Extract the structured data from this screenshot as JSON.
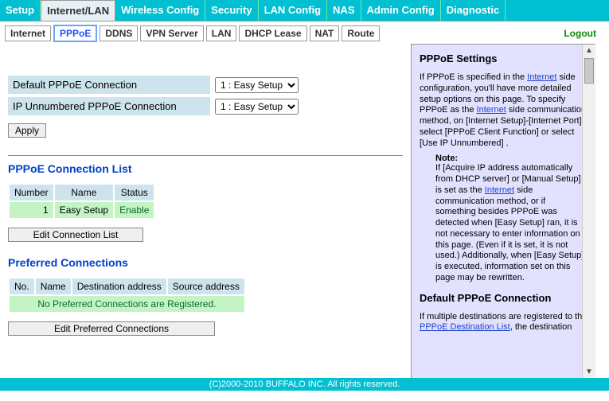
{
  "topnav": {
    "tabs": [
      {
        "label": "Setup"
      },
      {
        "label": "Internet/LAN"
      },
      {
        "label": "Wireless Config"
      },
      {
        "label": "Security"
      },
      {
        "label": "LAN Config"
      },
      {
        "label": "NAS"
      },
      {
        "label": "Admin Config"
      },
      {
        "label": "Diagnostic"
      }
    ],
    "active_index": 1
  },
  "subnav": {
    "tabs": [
      {
        "label": "Internet"
      },
      {
        "label": "PPPoE"
      },
      {
        "label": "DDNS"
      },
      {
        "label": "VPN Server"
      },
      {
        "label": "LAN"
      },
      {
        "label": "DHCP Lease"
      },
      {
        "label": "NAT"
      },
      {
        "label": "Route"
      }
    ],
    "active_index": 1,
    "logout": "Logout"
  },
  "form": {
    "default_label": "Default PPPoE Connection",
    "default_selected": "1 : Easy Setup",
    "ipun_label": "IP Unnumbered PPPoE Connection",
    "ipun_selected": "1 : Easy Setup",
    "options": [
      "1 : Easy Setup"
    ],
    "apply": "Apply"
  },
  "conn_list": {
    "title": "PPPoE Connection List",
    "headers": {
      "number": "Number",
      "name": "Name",
      "status": "Status"
    },
    "rows": [
      {
        "number": "1",
        "name": "Easy Setup",
        "status": "Enable"
      }
    ],
    "button": "Edit Connection List"
  },
  "preferred": {
    "title": "Preferred Connections",
    "headers": {
      "no": "No.",
      "name": "Name",
      "dest": "Destination address",
      "src": "Source address"
    },
    "empty_msg": "No Preferred Connections are Registered.",
    "button": "Edit Preferred Connections"
  },
  "side": {
    "title": "PPPoE Settings",
    "p1a": "If PPPoE is specified in the ",
    "p1link1": "Internet",
    "p1b": " side configuration, you'll have more detailed setup options on this page. To specify PPPoE as the ",
    "p1link2": "Internet",
    "p1c": " side communication method, on [Internet Setup]-[Internet Port], select [PPPoE Client Function] or select [Use IP Unnumbered] .",
    "note_title": "Note:",
    "note_a": "If [Acquire IP address automatically from DHCP server] or [Manual Setup] is set as the ",
    "note_link": "Internet",
    "note_b": " side communication method, or if something besides PPPoE was detected when [Easy Setup] ran, it is not necessary to enter information on this page. (Even if it is set, it is not used.) Additionally, when [Easy Setup] is executed, information set on this page may be rewritten.",
    "h2": "Default PPPoE Connection",
    "p2a": "If multiple destinations are registered to the ",
    "p2link": "PPPoE Destination List",
    "p2b": ", the destination"
  },
  "footer": "(C)2000-2010 BUFFALO INC. All rights reserved."
}
